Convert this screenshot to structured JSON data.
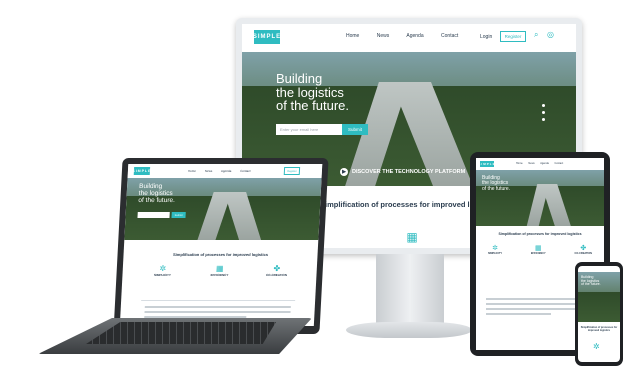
{
  "brand": {
    "logo": "SIMPLE",
    "accent": "#2fbcc1",
    "dark": "#2b3d4f"
  },
  "nav": {
    "home": "Home",
    "news": "News",
    "agenda": "Agenda",
    "contact": "Contact",
    "login": "Login",
    "register": "Register"
  },
  "hero": {
    "title_line1": "Building",
    "title_line2": "the logistics",
    "title_line3": "of the future.",
    "email_placeholder": "Enter your email here",
    "submit": "Submit",
    "discover_cta": "DISCOVER THE TECHNOLOGY PLATFORM"
  },
  "section": {
    "title": "Simplification of processes for improved logistics"
  },
  "features": [
    {
      "icon": "network-icon",
      "title": "SIMPLICITY"
    },
    {
      "icon": "chart-icon",
      "title": "EFFICIENCY"
    },
    {
      "icon": "share-icon",
      "title": "CO-CREATION"
    }
  ],
  "icons": {
    "search": "search-icon",
    "globe": "globe-icon",
    "play": "play-icon"
  }
}
